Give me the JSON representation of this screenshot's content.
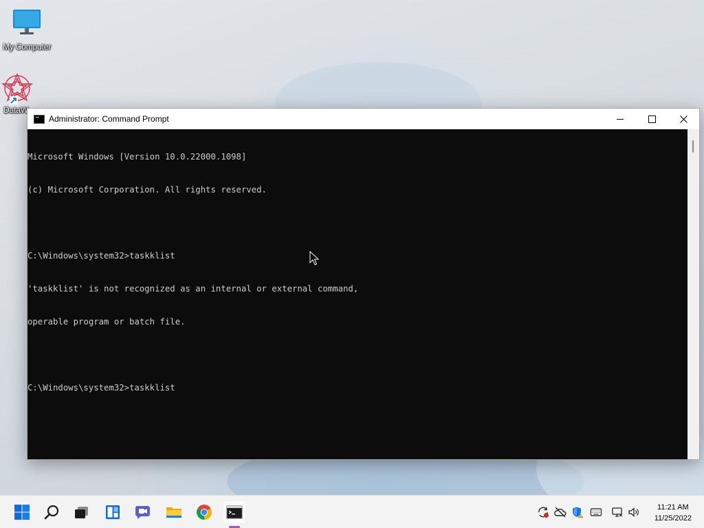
{
  "desktop": {
    "icons": [
      {
        "label": "My Computer",
        "icon": "monitor-icon"
      },
      {
        "label": "DataW",
        "icon": "datawatch-icon"
      }
    ]
  },
  "window": {
    "title": "Administrator: Command Prompt",
    "controls": [
      "minimize",
      "maximize",
      "close"
    ]
  },
  "console": {
    "lines": [
      "Microsoft Windows [Version 10.0.22000.1098]",
      "(c) Microsoft Corporation. All rights reserved.",
      "",
      "C:\\Windows\\system32>taskklist",
      "'taskklist' is not recognized as an internal or external command,",
      "operable program or batch file.",
      "",
      "C:\\Windows\\system32>taskklist"
    ]
  },
  "taskbar": {
    "apps": [
      {
        "name": "start",
        "icon": "windows-start-icon"
      },
      {
        "name": "search",
        "icon": "search-icon"
      },
      {
        "name": "task-view",
        "icon": "task-view-icon"
      },
      {
        "name": "widgets",
        "icon": "widgets-icon"
      },
      {
        "name": "chat",
        "icon": "teams-chat-icon"
      },
      {
        "name": "file-explorer",
        "icon": "folder-icon"
      },
      {
        "name": "chrome",
        "icon": "chrome-icon"
      },
      {
        "name": "command-prompt",
        "icon": "cmd-icon",
        "active": true
      }
    ],
    "tray": [
      "sync-icon",
      "onedrive-icon",
      "security-icon",
      "keyboard-icon",
      "network-icon",
      "volume-icon"
    ],
    "time": "11:21 AM",
    "date": "11/25/2022"
  },
  "colors": {
    "console_bg": "#0c0c0c",
    "console_fg": "#cccccc",
    "active_indicator": "#b14ccf"
  }
}
